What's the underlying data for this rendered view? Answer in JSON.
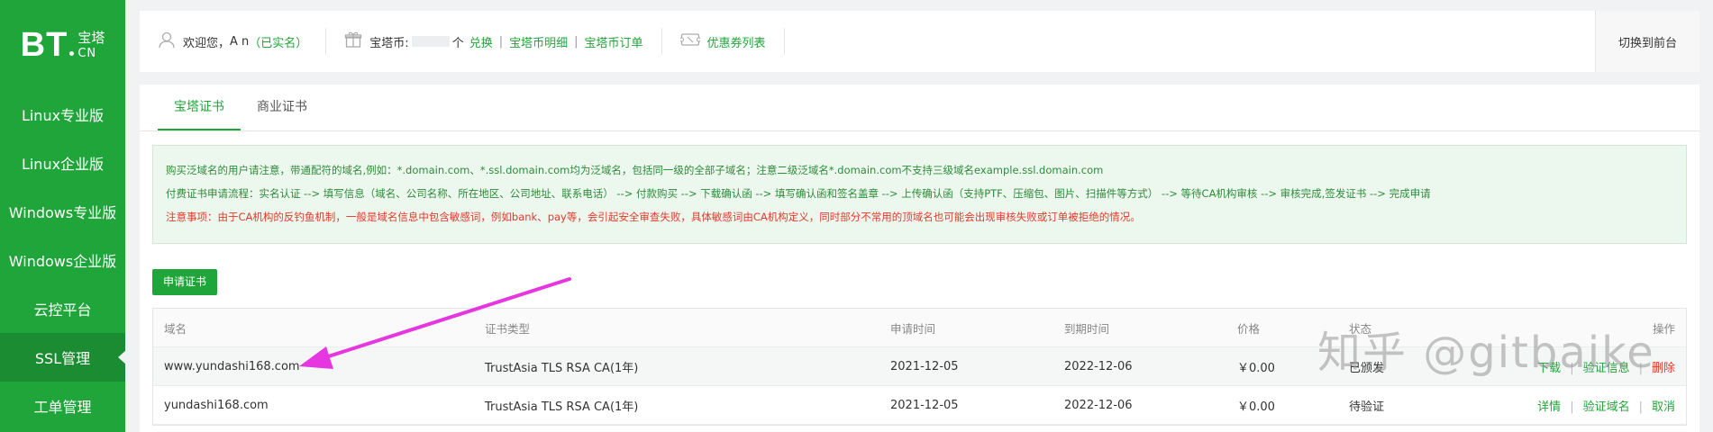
{
  "logo": {
    "bt": "BT",
    "cn_top": "宝塔",
    "cn_bottom": "CN"
  },
  "sidebar": {
    "items": [
      {
        "label": "Linux专业版"
      },
      {
        "label": "Linux企业版"
      },
      {
        "label": "Windows专业版"
      },
      {
        "label": "Windows企业版"
      },
      {
        "label": "云控平台"
      },
      {
        "label": "SSL管理"
      },
      {
        "label": "工单管理"
      }
    ],
    "active_index": 5
  },
  "topbar": {
    "welcome_prefix": "欢迎您，",
    "username": "A    n",
    "realname_status": "（已实名）",
    "coin_label": "宝塔币:",
    "coin_unit": "个",
    "exchange": "兑换",
    "coin_detail": "宝塔币明细",
    "coin_order": "宝塔币订单",
    "coupon_list": "优惠券列表",
    "switch_front": "切换到前台"
  },
  "tabs": [
    {
      "label": "宝塔证书",
      "active": true
    },
    {
      "label": "商业证书",
      "active": false
    }
  ],
  "notice": {
    "line1": "购买泛域名的用户请注意，带通配符的域名,例如：*.domain.com、*.ssl.domain.com均为泛域名，包括同一级的全部子域名；注意二级泛域名*.domain.com不支持三级域名example.ssl.domain.com",
    "line2": "付费证书申请流程：实名认证 --> 填写信息（域名、公司名称、所在地区、公司地址、联系电话） --> 付款购买 --> 下载确认函 --> 填写确认函和签名盖章 --> 上传确认函（支持PTF、压缩包、图片、扫描件等方式） --> 等待CA机构审核 --> 审核完成,签发证书 --> 完成申请",
    "line3": "注意事项：由于CA机构的反钓鱼机制，一般是域名信息中包含敏感词，例如bank、pay等，会引起安全审查失败，具体敏感词由CA机构定义，同时部分不常用的顶域名也可能会出现审核失败或订单被拒绝的情况。"
  },
  "apply_button": "申请证书",
  "table": {
    "headers": [
      "域名",
      "证书类型",
      "申请时间",
      "到期时间",
      "价格",
      "状态",
      "操作"
    ],
    "rows": [
      {
        "domain": "www.yundashi168.com",
        "type": "TrustAsia TLS RSA CA(1年)",
        "apply": "2021-12-05",
        "expire": "2022-12-06",
        "price": "￥0.00",
        "status": "已颁发",
        "ops": [
          "下载",
          "验证信息",
          "删除"
        ]
      },
      {
        "domain": "yundashi168.com",
        "type": "TrustAsia TLS RSA CA(1年)",
        "apply": "2021-12-05",
        "expire": "2022-12-06",
        "price": "￥0.00",
        "status": "待验证",
        "ops": [
          "详情",
          "验证域名",
          "取消"
        ]
      }
    ]
  },
  "watermark": "知乎 @gitbaike",
  "colors": {
    "brand": "#20a53a",
    "brand_dark": "#1b8c31",
    "danger": "#e33a2c",
    "annotation_arrow": "#e536e0"
  }
}
